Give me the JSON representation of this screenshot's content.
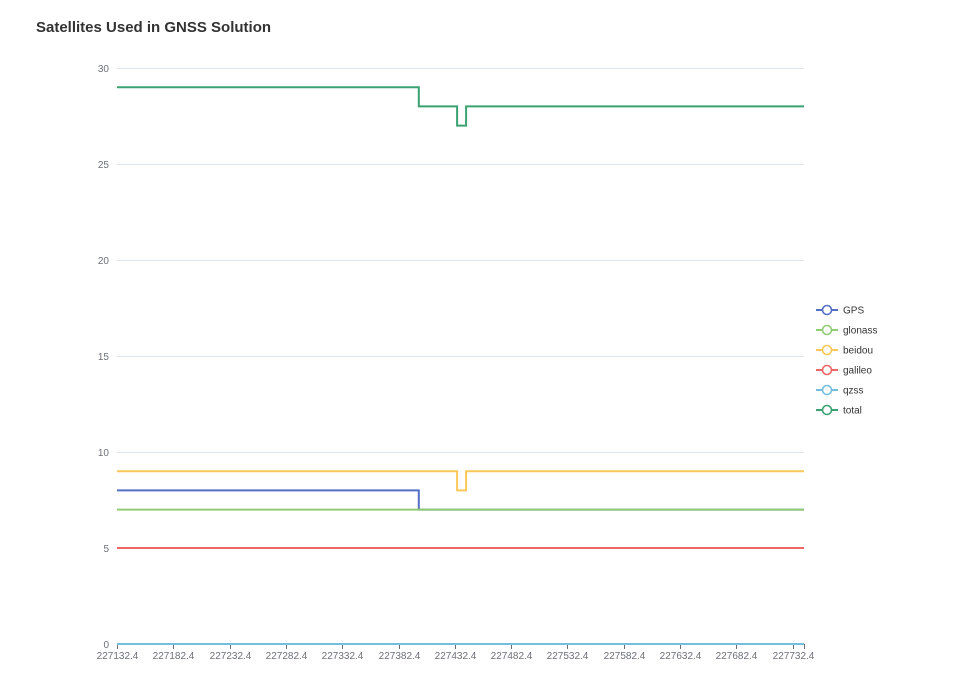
{
  "chart_data": {
    "type": "line",
    "step": true,
    "title": "Satellites Used in GNSS Solution",
    "xlabel": "",
    "ylabel": "",
    "x_ticks": [
      "227132.4",
      "227182.4",
      "227232.4",
      "227282.4",
      "227332.4",
      "227382.4",
      "227432.4",
      "227482.4",
      "227532.4",
      "227582.4",
      "227632.4",
      "227682.4",
      "227732.4"
    ],
    "xlim": [
      227132.4,
      227742.4
    ],
    "ylim": [
      0,
      30
    ],
    "y_ticks": [
      0,
      5,
      10,
      15,
      20,
      25,
      30
    ],
    "grid": true,
    "legend_position": "right",
    "series": [
      {
        "name": "GPS",
        "color": "#5470c6",
        "points": [
          [
            227132.4,
            8
          ],
          [
            227400.4,
            8
          ],
          [
            227400.4,
            7
          ],
          [
            227742.4,
            7
          ]
        ]
      },
      {
        "name": "glonass",
        "color": "#91cc75",
        "points": [
          [
            227132.4,
            7
          ],
          [
            227742.4,
            7
          ]
        ]
      },
      {
        "name": "beidou",
        "color": "#fac858",
        "points": [
          [
            227132.4,
            9
          ],
          [
            227434.4,
            9
          ],
          [
            227434.4,
            8
          ],
          [
            227442.4,
            8
          ],
          [
            227442.4,
            9
          ],
          [
            227742.4,
            9
          ]
        ]
      },
      {
        "name": "galileo",
        "color": "#ee6666",
        "points": [
          [
            227132.4,
            5
          ],
          [
            227742.4,
            5
          ]
        ]
      },
      {
        "name": "qzss",
        "color": "#73c0de",
        "points": [
          [
            227132.4,
            0
          ],
          [
            227742.4,
            0
          ]
        ]
      },
      {
        "name": "total",
        "color": "#3ba272",
        "points": [
          [
            227132.4,
            29
          ],
          [
            227400.4,
            29
          ],
          [
            227400.4,
            28
          ],
          [
            227434.4,
            28
          ],
          [
            227434.4,
            27
          ],
          [
            227442.4,
            27
          ],
          [
            227442.4,
            28
          ],
          [
            227742.4,
            28
          ]
        ]
      }
    ]
  }
}
